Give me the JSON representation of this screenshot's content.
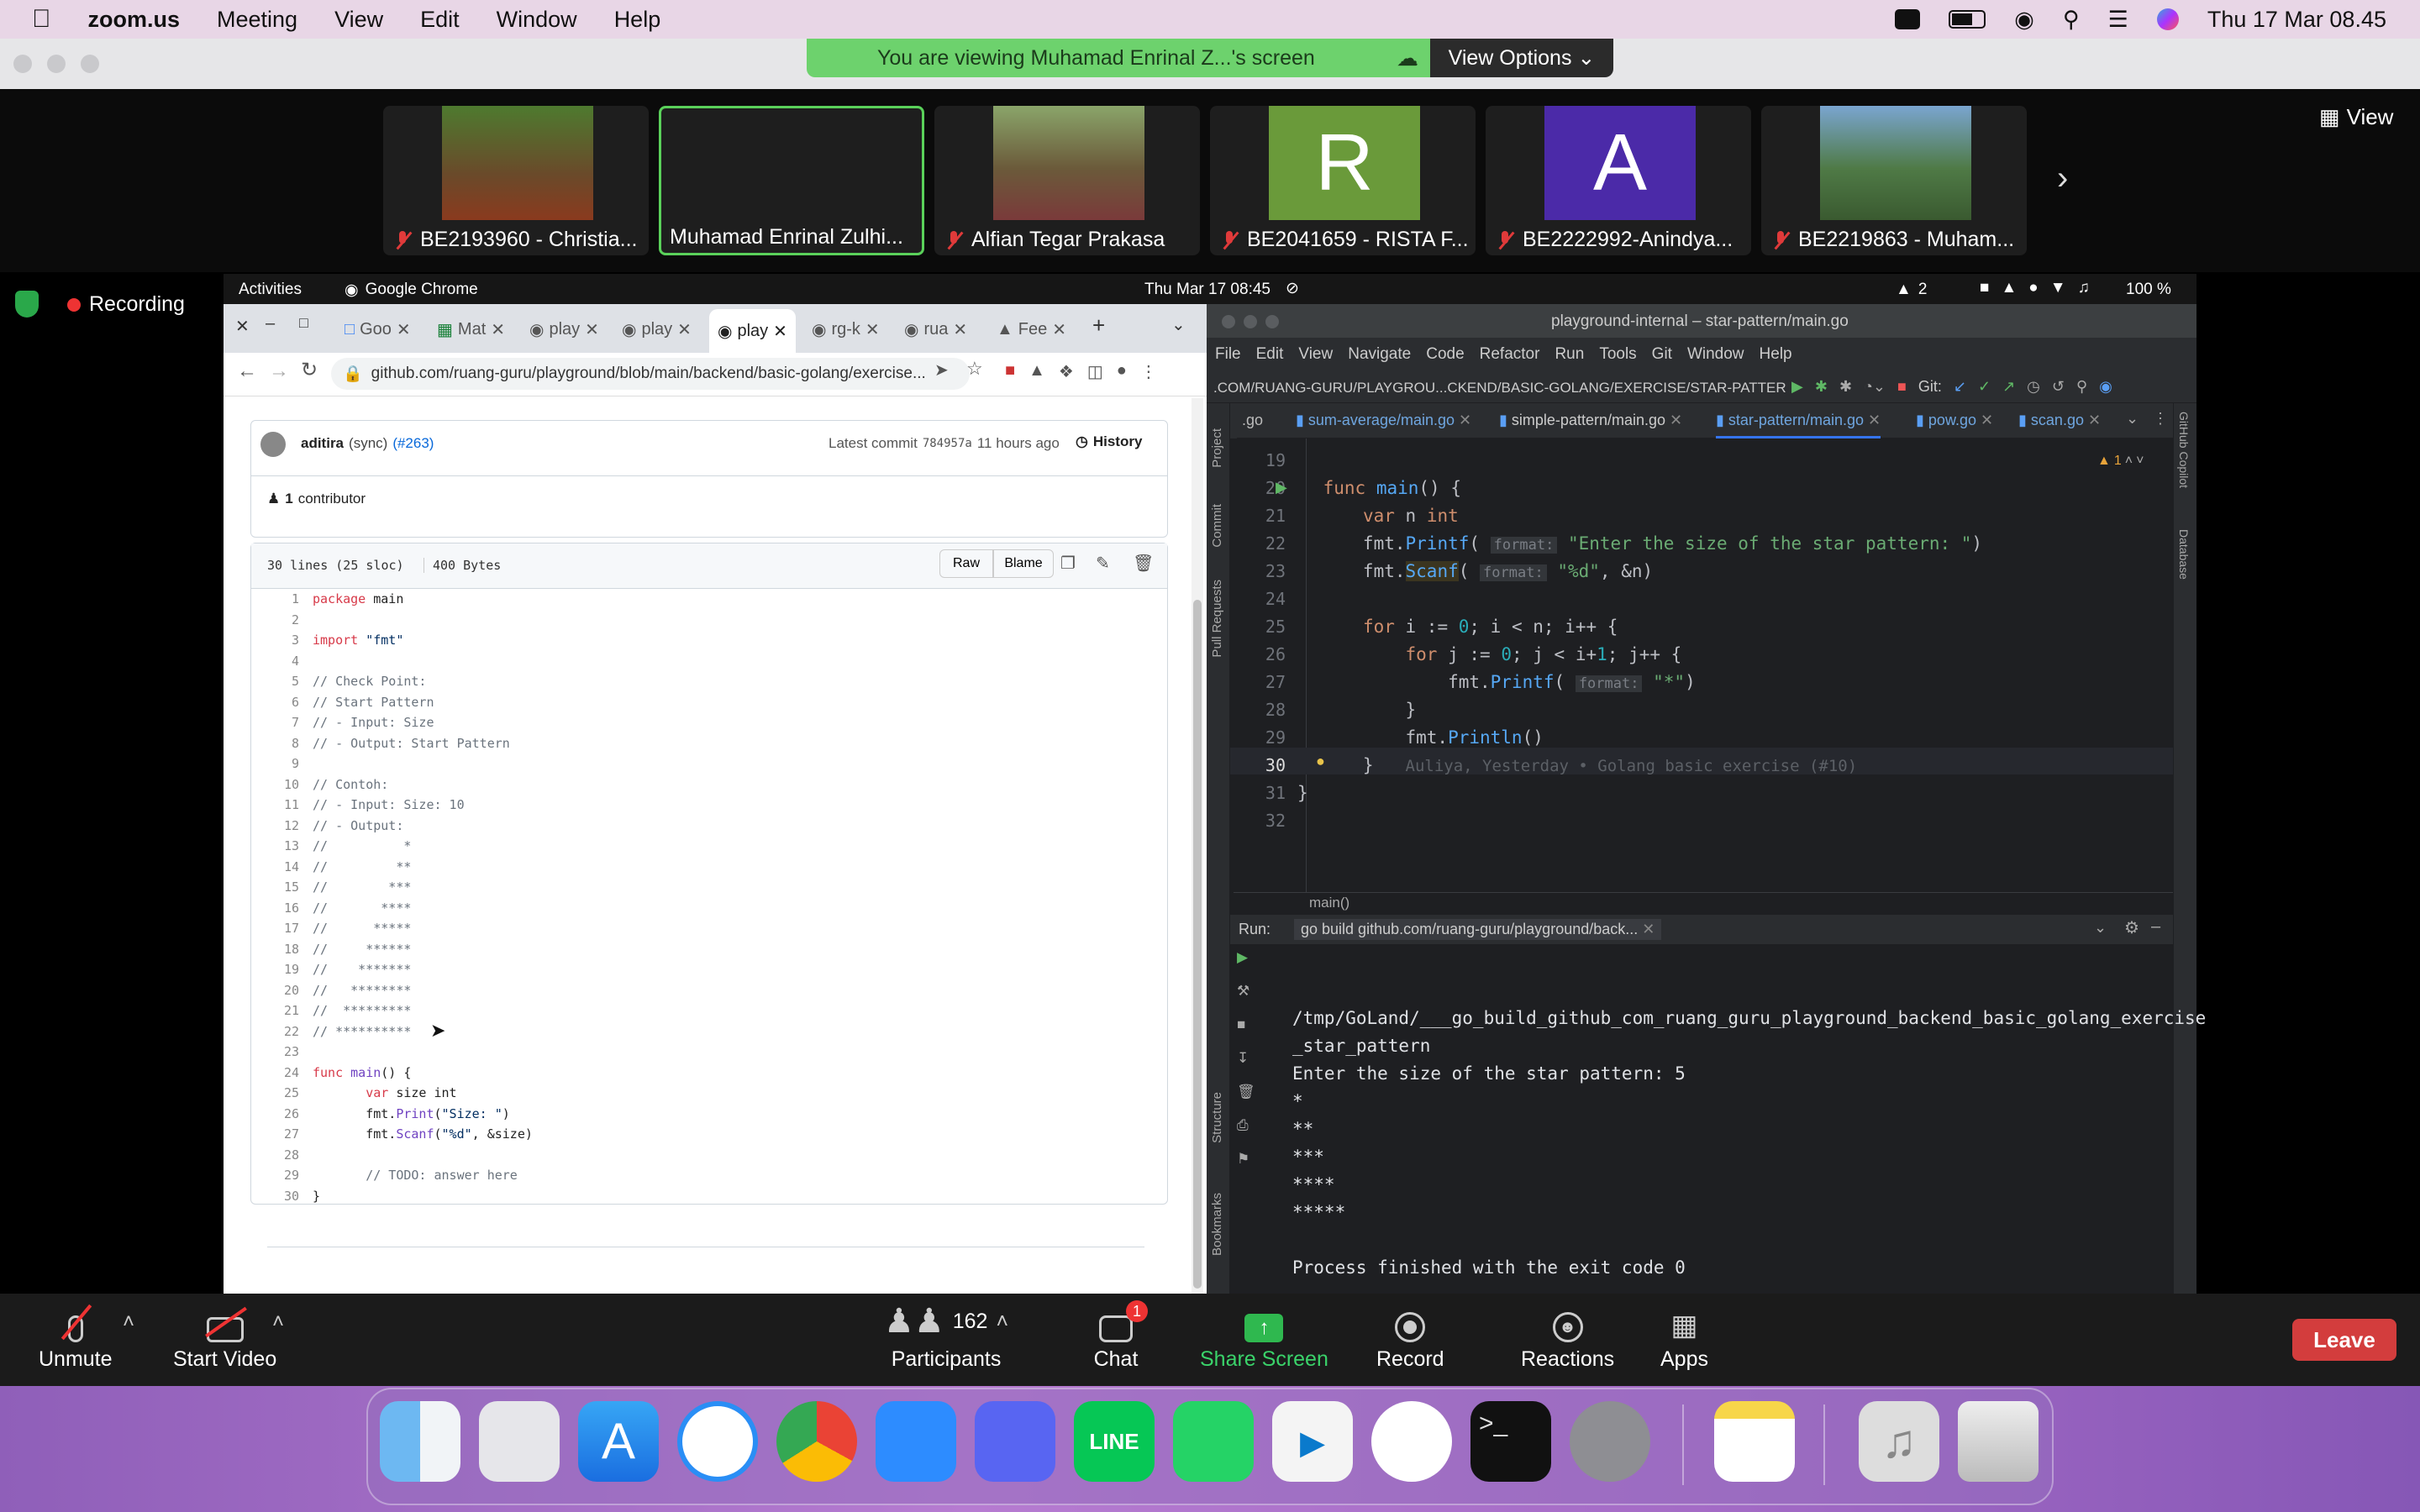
{
  "menubar": {
    "app": "zoom.us",
    "items": [
      "Meeting",
      "View",
      "Edit",
      "Window",
      "Help"
    ],
    "datetime": "Thu 17 Mar  08.45"
  },
  "banner": {
    "text": "You are viewing Muhamad Enrinal Z...'s screen",
    "view_options": "View Options"
  },
  "gallery": {
    "view_label": "View",
    "participants": [
      {
        "name": "BE2193960 - Christia...",
        "muted": true,
        "bg": "#5b4a2f"
      },
      {
        "name": "Muhamad Enrinal Zulhi...",
        "muted": false,
        "bg": "#1e1e1e"
      },
      {
        "name": "Alfian Tegar Prakasa",
        "muted": true,
        "bg": "#6a5b3d"
      },
      {
        "name": "BE2041659 - RISTA F...",
        "muted": true,
        "bg": "#6a9a3a",
        "initial": "R"
      },
      {
        "name": "BE2222992-Anindya...",
        "muted": true,
        "bg": "#4b2aa8",
        "initial": "A"
      },
      {
        "name": "BE2219863 - Muham...",
        "muted": true,
        "bg": "#4f7a46"
      }
    ]
  },
  "recording": {
    "label": "Recording"
  },
  "ubuntu": {
    "activities": "Activities",
    "app": "Google Chrome",
    "clock": "Thu Mar 17  08:45",
    "battery": "100 %",
    "net": "2"
  },
  "chrome": {
    "tabs": [
      "Goo",
      "Mat",
      "play",
      "play",
      "play",
      "rg-k",
      "rua",
      "Fee"
    ],
    "url": "github.com/ruang-guru/playground/blob/main/backend/basic-golang/exercise...",
    "commit": {
      "author": "aditira",
      "msg": "(sync)",
      "pr": "(#263)",
      "latest": "Latest commit",
      "sha": "784957a",
      "time": "11 hours ago",
      "history": "History"
    },
    "contributors": {
      "count": "1",
      "label": "contributor"
    },
    "fileinfo": {
      "lines": "30 lines (25 sloc)",
      "size": "400 Bytes",
      "raw": "Raw",
      "blame": "Blame"
    }
  },
  "goland": {
    "title": "playground-internal – star-pattern/main.go",
    "menu": [
      "File",
      "Edit",
      "View",
      "Navigate",
      "Code",
      "Refactor",
      "Run",
      "Tools",
      "Git",
      "Window",
      "Help"
    ],
    "path": ".COM/RUANG-GURU/PLAYGROU...CKEND/BASIC-GOLANG/EXERCISE/STAR-PATTER",
    "git_label": "Git:",
    "tabs": [
      ".go",
      "sum-average/main.go",
      "simple-pattern/main.go",
      "star-pattern/main.go",
      "pow.go",
      "scan.go"
    ],
    "blame": "Auliya, Yesterday • Golang basic exercise (#10)",
    "breadcrumb": "main()",
    "warnings": "1",
    "run_label": "Run:",
    "run_tab": "go build github.com/ruang-guru/playground/back...",
    "output": [
      "/tmp/GoLand/___go_build_github_com_ruang_guru_playground_backend_basic_golang_exercise",
      "_star_pattern",
      "Enter the size of the star pattern: 5",
      "*",
      "**",
      "***",
      "****",
      "*****",
      "",
      "Process finished with the exit code 0"
    ],
    "side_left": [
      "Project",
      "Commit",
      "Pull Requests",
      "Structure",
      "Bookmarks"
    ],
    "side_right": [
      "GitHub Copilot",
      "Database"
    ]
  },
  "toolbar": {
    "unmute": "Unmute",
    "start_video": "Start Video",
    "participants": "Participants",
    "participant_count": "162",
    "chat": "Chat",
    "chat_badge": "1",
    "share": "Share Screen",
    "record": "Record",
    "reactions": "Reactions",
    "apps": "Apps",
    "leave": "Leave"
  }
}
